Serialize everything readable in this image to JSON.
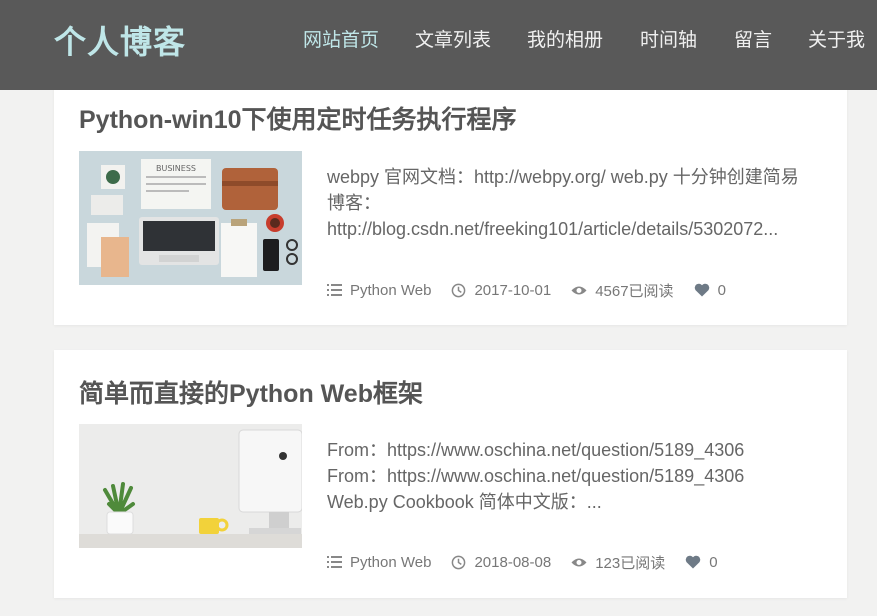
{
  "header": {
    "logo": "个人博客",
    "nav": [
      {
        "label": "网站首页",
        "active": true
      },
      {
        "label": "文章列表",
        "active": false
      },
      {
        "label": "我的相册",
        "active": false
      },
      {
        "label": "时间轴",
        "active": false
      },
      {
        "label": "留言",
        "active": false
      },
      {
        "label": "关于我",
        "active": false
      }
    ]
  },
  "posts": [
    {
      "title": "Python-win10下使用定时任务执行程序",
      "excerpt": [
        "webpy 官网文档：http://webpy.org/ web.py 十分钟创建简易",
        "博客：",
        "http://blog.csdn.net/freeking101/article/details/5302072..."
      ],
      "thumb_sign": "BUSINESS",
      "category": "Python Web",
      "date": "2017-10-01",
      "views": "4567已阅读",
      "likes": "0"
    },
    {
      "title": "简单而直接的Python Web框架",
      "excerpt": [
        "From：https://www.oschina.net/question/5189_4306",
        "From：https://www.oschina.net/question/5189_4306",
        "Web.py Cookbook 简体中文版：..."
      ],
      "category": "Python Web",
      "date": "2018-08-08",
      "views": "123已阅读",
      "likes": "0"
    }
  ],
  "colors": {
    "header_bg": "#595959",
    "accent": "#bfe6e8",
    "page_bg": "#f2f2f1",
    "card_bg": "#ffffff"
  }
}
